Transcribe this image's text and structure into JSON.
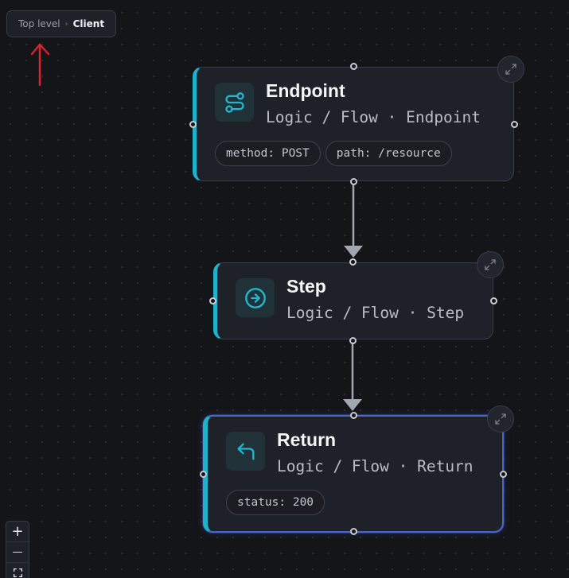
{
  "breadcrumb": {
    "root": "Top level",
    "separator": "›",
    "current": "Client"
  },
  "annotation": {
    "icon": "up-arrow-icon",
    "color": "#e0222a"
  },
  "theme": {
    "accent": "#1eb3cd",
    "selected_border": "#4a66c9"
  },
  "nodes": [
    {
      "id": "endpoint",
      "title": "Endpoint",
      "subtitle": "Logic / Flow · Endpoint",
      "icon": "route-icon",
      "chips": [
        "method: POST",
        "path: /resource"
      ]
    },
    {
      "id": "step",
      "title": "Step",
      "subtitle": "Logic / Flow · Step",
      "icon": "arrow-right-circle-icon",
      "chips": []
    },
    {
      "id": "return",
      "title": "Return",
      "subtitle": "Logic / Flow · Return",
      "icon": "corner-up-left-icon",
      "chips": [
        "status: 200"
      ],
      "selected": true
    }
  ],
  "edges": [
    {
      "from": "endpoint",
      "to": "step"
    },
    {
      "from": "step",
      "to": "return"
    }
  ],
  "controls": {
    "zoom_in": "+",
    "zoom_out": "—",
    "fit_view_icon": "fit-view-icon"
  }
}
